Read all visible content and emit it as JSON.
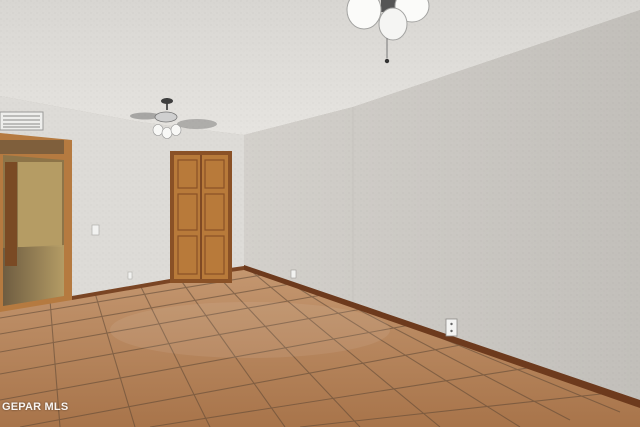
{
  "photo": {
    "watermark_text": "GEPAR MLS",
    "colors": {
      "ceiling": "#dedcd8",
      "right_wall": "#c9c6c1",
      "left_wall": "#dcdad6",
      "door_wood": "#b87a3a",
      "baseboard": "#6d3a1d",
      "floor_tile": "#b9865a",
      "floor_grout": "#5b4634"
    },
    "icons": [
      "ceiling-fan-icon",
      "ceiling-fan-icon",
      "hvac-vent-icon",
      "electrical-outlet-icon",
      "light-switch-icon"
    ]
  }
}
